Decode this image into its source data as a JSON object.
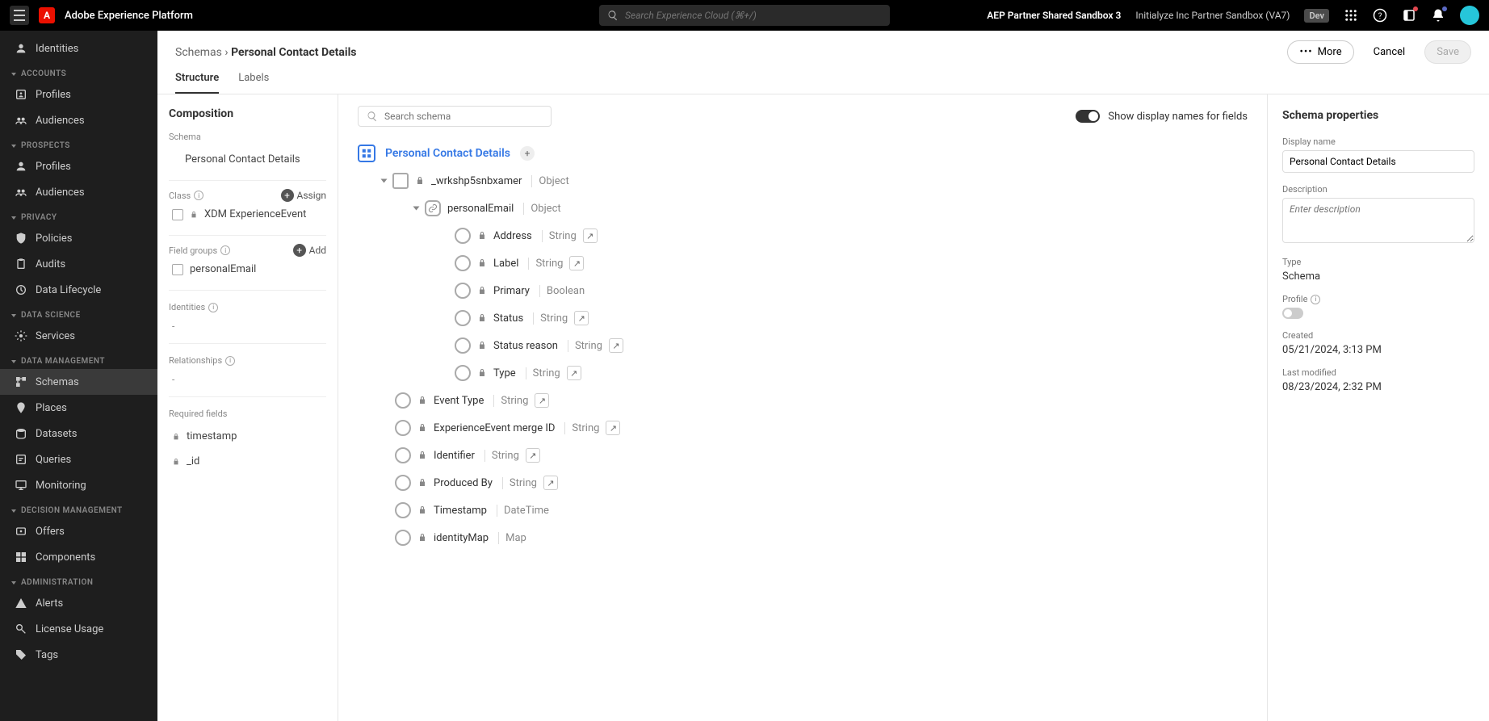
{
  "topbar": {
    "title": "Adobe Experience Platform",
    "search_placeholder": "Search Experience Cloud (⌘+/)",
    "sandbox": "AEP Partner Shared Sandbox 3",
    "org": "Initialyze Inc Partner Sandbox (VA7)",
    "dev": "Dev"
  },
  "leftnav": {
    "top_item": "Identities",
    "sections": [
      {
        "header": "ACCOUNTS",
        "items": [
          {
            "label": "Profiles",
            "icon": "profile"
          },
          {
            "label": "Audiences",
            "icon": "audiences"
          }
        ]
      },
      {
        "header": "PROSPECTS",
        "items": [
          {
            "label": "Profiles",
            "icon": "person"
          },
          {
            "label": "Audiences",
            "icon": "audiences"
          }
        ]
      },
      {
        "header": "PRIVACY",
        "items": [
          {
            "label": "Policies",
            "icon": "shield"
          },
          {
            "label": "Audits",
            "icon": "clipboard"
          },
          {
            "label": "Data Lifecycle",
            "icon": "lifecycle"
          }
        ]
      },
      {
        "header": "DATA SCIENCE",
        "items": [
          {
            "label": "Services",
            "icon": "gear"
          }
        ]
      },
      {
        "header": "DATA MANAGEMENT",
        "items": [
          {
            "label": "Schemas",
            "icon": "schema",
            "active": true
          },
          {
            "label": "Places",
            "icon": "pin"
          },
          {
            "label": "Datasets",
            "icon": "dataset"
          },
          {
            "label": "Queries",
            "icon": "query"
          },
          {
            "label": "Monitoring",
            "icon": "monitor"
          }
        ]
      },
      {
        "header": "DECISION MANAGEMENT",
        "items": [
          {
            "label": "Offers",
            "icon": "offers"
          },
          {
            "label": "Components",
            "icon": "components"
          }
        ]
      },
      {
        "header": "ADMINISTRATION",
        "items": [
          {
            "label": "Alerts",
            "icon": "alert"
          },
          {
            "label": "License Usage",
            "icon": "license"
          },
          {
            "label": "Tags",
            "icon": "tag"
          }
        ]
      }
    ]
  },
  "breadcrumb": {
    "parent": "Schemas",
    "current": "Personal Contact Details"
  },
  "buttons": {
    "more": "More",
    "cancel": "Cancel",
    "save": "Save"
  },
  "tabs": {
    "t1": "Structure",
    "t2": "Labels"
  },
  "composition": {
    "title": "Composition",
    "schema_label": "Schema",
    "schema_name": "Personal Contact Details",
    "class_label": "Class",
    "assign": "Assign",
    "class_item": "XDM ExperienceEvent",
    "fieldgroups_label": "Field groups",
    "add": "Add",
    "fg_item": "personalEmail",
    "identities_label": "Identities",
    "relationships_label": "Relationships",
    "required_label": "Required fields",
    "req1": "timestamp",
    "req2": "_id",
    "dash": "-"
  },
  "canvas": {
    "search_placeholder": "Search schema",
    "toggle_label": "Show display names for fields",
    "root": "Personal Contact Details",
    "n1": {
      "name": "_wrkshp5snbxamer",
      "type": "Object"
    },
    "n2": {
      "name": "personalEmail",
      "type": "Object"
    },
    "email_children": [
      {
        "name": "Address",
        "type": "String",
        "arrow": true
      },
      {
        "name": "Label",
        "type": "String",
        "arrow": true
      },
      {
        "name": "Primary",
        "type": "Boolean",
        "arrow": false
      },
      {
        "name": "Status",
        "type": "String",
        "arrow": true
      },
      {
        "name": "Status reason",
        "type": "String",
        "arrow": true
      },
      {
        "name": "Type",
        "type": "String",
        "arrow": true
      }
    ],
    "root_children": [
      {
        "name": "Event Type",
        "type": "String",
        "arrow": true
      },
      {
        "name": "ExperienceEvent merge ID",
        "type": "String",
        "arrow": true
      },
      {
        "name": "Identifier",
        "type": "String",
        "arrow": true
      },
      {
        "name": "Produced By",
        "type": "String",
        "arrow": true
      },
      {
        "name": "Timestamp",
        "type": "DateTime",
        "arrow": false
      },
      {
        "name": "identityMap",
        "type": "Map",
        "arrow": false
      }
    ]
  },
  "props": {
    "title": "Schema properties",
    "display_name_label": "Display name",
    "display_name": "Personal Contact Details",
    "description_label": "Description",
    "description_placeholder": "Enter description",
    "type_label": "Type",
    "type_value": "Schema",
    "profile_label": "Profile",
    "created_label": "Created",
    "created_value": "05/21/2024, 3:13 PM",
    "modified_label": "Last modified",
    "modified_value": "08/23/2024, 2:32 PM"
  }
}
